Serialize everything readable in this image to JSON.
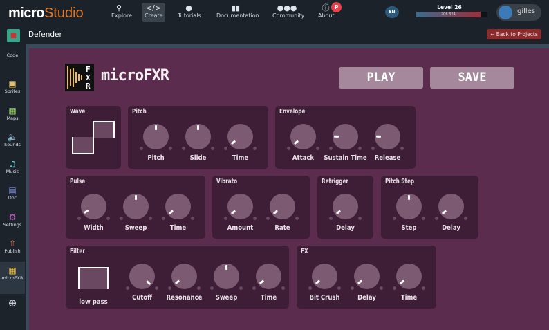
{
  "header": {
    "logo_bold": "micro",
    "logo_light": "Studio",
    "nav": [
      {
        "label": "Explore",
        "icon": "search-icon"
      },
      {
        "label": "Create",
        "icon": "code-icon"
      },
      {
        "label": "Tutorials",
        "icon": "lightbulb-icon"
      },
      {
        "label": "Documentation",
        "icon": "book-icon"
      },
      {
        "label": "Community",
        "icon": "users-icon"
      },
      {
        "label": "About",
        "icon": "info-icon"
      }
    ],
    "language": "EN",
    "level_label": "Level 26",
    "xp": "206 324",
    "xp_progress": 0.9,
    "username": "gilles"
  },
  "project": {
    "name": "Defender",
    "back_label": "Back to Projects"
  },
  "sidebar": [
    {
      "label": "Code",
      "icon": "code-icon",
      "color": "#e8685a"
    },
    {
      "label": "Sprites",
      "icon": "image-icon",
      "color": "#e8c05a"
    },
    {
      "label": "Maps",
      "icon": "map-icon",
      "color": "#9bd46a"
    },
    {
      "label": "Sounds",
      "icon": "volume-icon",
      "color": "#5ad47a"
    },
    {
      "label": "Music",
      "icon": "music-icon",
      "color": "#5ad4d4"
    },
    {
      "label": "Doc",
      "icon": "doc-icon",
      "color": "#7a8ae8"
    },
    {
      "label": "Settings",
      "icon": "gear-icon",
      "color": "#d46ad4"
    },
    {
      "label": "Publish",
      "icon": "upload-icon",
      "color": "#e8685a"
    },
    {
      "label": "microFXR",
      "icon": "microfxr-icon",
      "color": "#f0c040"
    }
  ],
  "app": {
    "title": "microFXR",
    "play_label": "PLAY",
    "save_label": "SAVE",
    "logo_letters": "FXR"
  },
  "panels": [
    {
      "title": "Wave",
      "display": {
        "type": "wave",
        "label": ""
      },
      "knobs": []
    },
    {
      "title": "Pitch",
      "knobs": [
        {
          "label": "Pitch",
          "value": 0.5
        },
        {
          "label": "Slide",
          "value": 0.5
        },
        {
          "label": "Time",
          "value": 0.02
        }
      ]
    },
    {
      "title": "Envelope",
      "knobs": [
        {
          "label": "Attack",
          "value": 0.02
        },
        {
          "label": "Sustain Time",
          "value": 0.17
        },
        {
          "label": "Release",
          "value": 0.17
        }
      ]
    },
    {
      "title": "Pulse",
      "knobs": [
        {
          "label": "Width",
          "value": 0.04
        },
        {
          "label": "Sweep",
          "value": 0.5
        },
        {
          "label": "Time",
          "value": 0.02
        }
      ]
    },
    {
      "title": "Vibrato",
      "knobs": [
        {
          "label": "Amount",
          "value": 0.02
        },
        {
          "label": "Rate",
          "value": 0.02
        }
      ]
    },
    {
      "title": "Retrigger",
      "knobs": [
        {
          "label": "Delay",
          "value": 0.02
        }
      ]
    },
    {
      "title": "Pitch Step",
      "knobs": [
        {
          "label": "Step",
          "value": 0.5
        },
        {
          "label": "Delay",
          "value": 0.02
        }
      ]
    },
    {
      "title": "Filter",
      "display": {
        "type": "lowpass",
        "label": "low pass"
      },
      "knobs": [
        {
          "label": "Cutoff",
          "value": 1.0
        },
        {
          "label": "Resonance",
          "value": 0.02
        },
        {
          "label": "Sweep",
          "value": 0.5
        },
        {
          "label": "Time",
          "value": 0.02
        }
      ]
    },
    {
      "title": "FX",
      "knobs": [
        {
          "label": "Bit Crush",
          "value": 0.02
        },
        {
          "label": "Delay",
          "value": 0.02
        },
        {
          "label": "Time",
          "value": 0.02
        }
      ]
    }
  ]
}
